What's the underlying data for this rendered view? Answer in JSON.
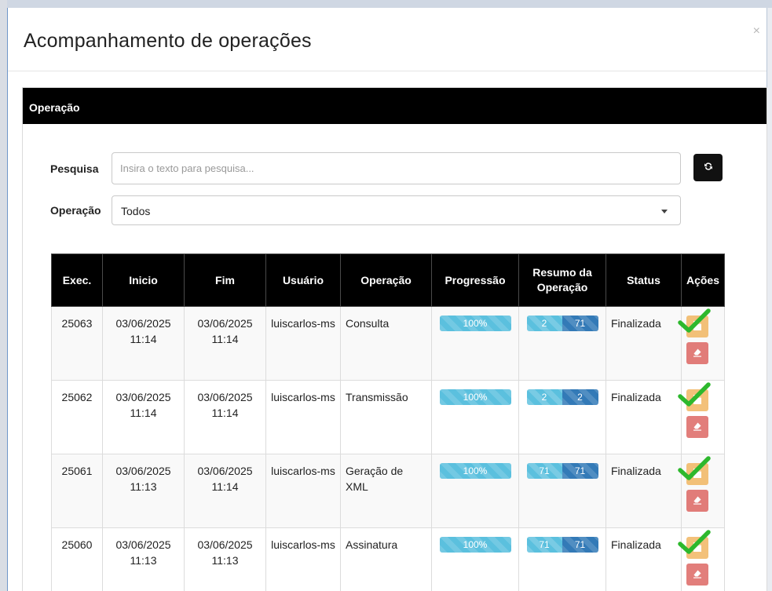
{
  "modal": {
    "title": "Acompanhamento de operações",
    "close_label": "×"
  },
  "panel": {
    "heading": "Operação"
  },
  "form": {
    "search_label": "Pesquisa",
    "search_placeholder": "Insira o texto para pesquisa...",
    "search_value": "",
    "operation_label": "Operação",
    "operation_selected": "Todos"
  },
  "table": {
    "headers": [
      "Exec.",
      "Inicio",
      "Fim",
      "Usuário",
      "Operação",
      "Progressão",
      "Resumo da Operação",
      "Status",
      "Ações"
    ],
    "rows": [
      {
        "exec": "25063",
        "inicio": "03/06/2025 11:14",
        "fim": "03/06/2025 11:14",
        "usuario": "luiscarlos-ms",
        "operacao": "Consulta",
        "progress": "100%",
        "resumo_a": "2",
        "resumo_b": "71",
        "status": "Finalizada"
      },
      {
        "exec": "25062",
        "inicio": "03/06/2025 11:14",
        "fim": "03/06/2025 11:14",
        "usuario": "luiscarlos-ms",
        "operacao": "Transmissão",
        "progress": "100%",
        "resumo_a": "2",
        "resumo_b": "2",
        "status": "Finalizada"
      },
      {
        "exec": "25061",
        "inicio": "03/06/2025 11:13",
        "fim": "03/06/2025 11:14",
        "usuario": "luiscarlos-ms",
        "operacao": "Geração de XML",
        "progress": "100%",
        "resumo_a": "71",
        "resumo_b": "71",
        "status": "Finalizada"
      },
      {
        "exec": "25060",
        "inicio": "03/06/2025 11:13",
        "fim": "03/06/2025 11:13",
        "usuario": "luiscarlos-ms",
        "operacao": "Assinatura",
        "progress": "100%",
        "resumo_a": "71",
        "resumo_b": "71",
        "status": "Finalizada"
      }
    ]
  },
  "icons": {
    "refresh": "refresh-icon",
    "view": "file-icon",
    "erase": "eraser-icon",
    "check": "checkmark-icon",
    "caret": "chevron-down-icon"
  },
  "colors": {
    "header_bg": "#000000",
    "progress": "#5bc0de",
    "resumo_dark": "#337ab7",
    "view_button": "#f0ad4e",
    "erase_button": "#d9534f",
    "check": "#2db82d"
  }
}
